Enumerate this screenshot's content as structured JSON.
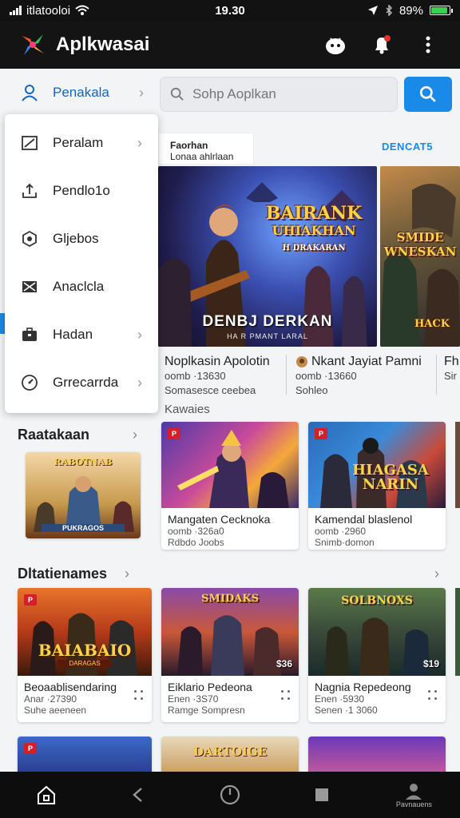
{
  "status_bar": {
    "carrier": "itlatooloi",
    "time": "19.30",
    "battery": "89%",
    "battery_level": 0.89
  },
  "app": {
    "title": "Aplkwasai"
  },
  "search": {
    "placeholder": "Sohp Aoplkan"
  },
  "drawer": {
    "header": "Penakala",
    "items": [
      {
        "label": "Peralam",
        "icon": "square-slash-icon",
        "has_chevron": true
      },
      {
        "label": "Pendlo1o",
        "icon": "upload-icon",
        "has_chevron": false
      },
      {
        "label": "Gljebos",
        "icon": "hexagon-icon",
        "has_chevron": false
      },
      {
        "label": "Anaclcla",
        "icon": "envelope-x-icon",
        "has_chevron": false
      },
      {
        "label": "Hadan",
        "icon": "briefcase-icon",
        "has_chevron": true
      },
      {
        "label": "Grrecarrda",
        "icon": "gauge-icon",
        "has_chevron": true
      }
    ]
  },
  "featured": {
    "tag_line1": "Faorhan",
    "tag_line2": "Lonaa ahlrlaan",
    "link": "DENCAT5",
    "banners": [
      {
        "logo_line1": "BAIRANK",
        "logo_line2": "UHIAKHAN",
        "logo_line3": "H DRAKARAN",
        "subtitle": "DENBJ DERKAN",
        "subtitle_small": "HA R PMANT LARAL",
        "title": "Noplkasin Apolotin",
        "meta1": "oomb ·13630",
        "meta2": "Somasesce ceebea"
      },
      {
        "logo_line1": "SMIDE",
        "logo_line2": "WNESKAN",
        "logo_line3": "",
        "subtitle": "",
        "subtitle_small": "",
        "title": "Nkant Jayiat Pamni",
        "meta1": "oomb ·13660",
        "meta2": "Sohleo"
      },
      {
        "logo_line1": "HACK",
        "logo_line2": "",
        "logo_line3": "",
        "subtitle": "",
        "subtitle_small": "",
        "title": "Fh",
        "meta1": "Sir",
        "meta2": ""
      }
    ]
  },
  "section1": {
    "title": "Raatakaan",
    "subtitle": "Kawaies",
    "left_card": {
      "logo1": "RABOTNAB",
      "logo2": "PUKRAGOS"
    },
    "cards": [
      {
        "title": "Mangaten Cecknoka",
        "meta1": "oomb ·326a0",
        "meta2": "Rdbdo Joobs",
        "badge": "P",
        "logo": ""
      },
      {
        "title": "Kamendal blaslenol",
        "meta1": "oomb ·2960",
        "meta2": "Snimb·domon",
        "badge": "P",
        "logo": "HIAGASA NARIN"
      }
    ]
  },
  "section2": {
    "title": "Dltatienames",
    "cards": [
      {
        "title": "Beoaablisendaring",
        "meta1": "Anar ·27390",
        "meta2": "Suhe aeeneen",
        "logo": "BAIABAIO",
        "logo_small": "DARAGAS",
        "price": ""
      },
      {
        "title": "Eiklario Pedeona",
        "meta1": "Enen ·3S70",
        "meta2": "Ramge Sompresn",
        "logo": "SMIDAKS",
        "logo_small": "",
        "price": "$36"
      },
      {
        "title": "Nagnia Repedeong",
        "meta1": "Enen ·5930",
        "meta2": "Senen ·1 3060",
        "logo": "SOLBNOXS",
        "logo_small": "",
        "price": "$19"
      }
    ],
    "row2_logos": [
      "",
      "DARTOIGE",
      ""
    ]
  },
  "bottom_nav": {
    "profile_label": "Pavnauens"
  },
  "colors": {
    "accent": "#1a8ae8",
    "appbar": "#141414",
    "statusbar": "#121212"
  }
}
